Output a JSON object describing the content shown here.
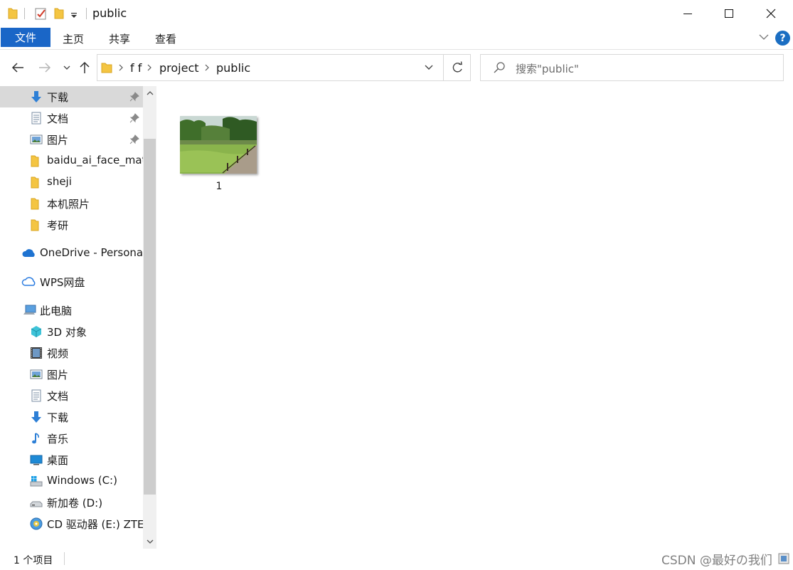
{
  "window": {
    "title": "public",
    "minimize_icon": "minimize-icon",
    "maximize_icon": "maximize-icon",
    "close_icon": "close-icon"
  },
  "ribbon": {
    "tabs": [
      {
        "label": "文件",
        "active": true
      },
      {
        "label": "主页"
      },
      {
        "label": "共享"
      },
      {
        "label": "查看"
      }
    ],
    "help_label": "?",
    "accent_color": "#1a66c7"
  },
  "address": {
    "crumbs": [
      "f f",
      "project",
      "public"
    ]
  },
  "search": {
    "placeholder": "搜索\"public\""
  },
  "nav": {
    "quick_access": [
      {
        "label": "下载",
        "icon": "download-arrow-icon",
        "pinned": true,
        "selected": true
      },
      {
        "label": "文档",
        "icon": "document-icon",
        "pinned": true
      },
      {
        "label": "图片",
        "icon": "pictures-icon",
        "pinned": true
      },
      {
        "label": "baidu_ai_face_mate",
        "icon": "folder-icon"
      },
      {
        "label": "sheji",
        "icon": "folder-icon"
      },
      {
        "label": "本机照片",
        "icon": "folder-icon"
      },
      {
        "label": "考研",
        "icon": "folder-icon"
      }
    ],
    "onedrive": {
      "label": "OneDrive - Personal",
      "icon": "onedrive-cloud-icon"
    },
    "wps": {
      "label": "WPS网盘",
      "icon": "wps-cloud-icon"
    },
    "this_pc": {
      "label": "此电脑",
      "icon": "computer-icon"
    },
    "pc_items": [
      {
        "label": "3D 对象",
        "icon": "3d-objects-icon"
      },
      {
        "label": "视频",
        "icon": "video-icon"
      },
      {
        "label": "图片",
        "icon": "pictures-icon"
      },
      {
        "label": "文档",
        "icon": "document-icon"
      },
      {
        "label": "下载",
        "icon": "download-arrow-icon"
      },
      {
        "label": "音乐",
        "icon": "music-note-icon"
      },
      {
        "label": "桌面",
        "icon": "desktop-icon"
      },
      {
        "label": "Windows  (C:)",
        "icon": "windows-drive-icon"
      },
      {
        "label": "新加卷 (D:)",
        "icon": "drive-icon"
      },
      {
        "label": "CD 驱动器 (E:) ZTEM",
        "icon": "cd-drive-icon"
      }
    ]
  },
  "content": {
    "files": [
      {
        "name": "1",
        "icon": "image-thumbnail"
      }
    ]
  },
  "status": {
    "count": "1 个项目",
    "watermark": "CSDN @最好の我们"
  }
}
